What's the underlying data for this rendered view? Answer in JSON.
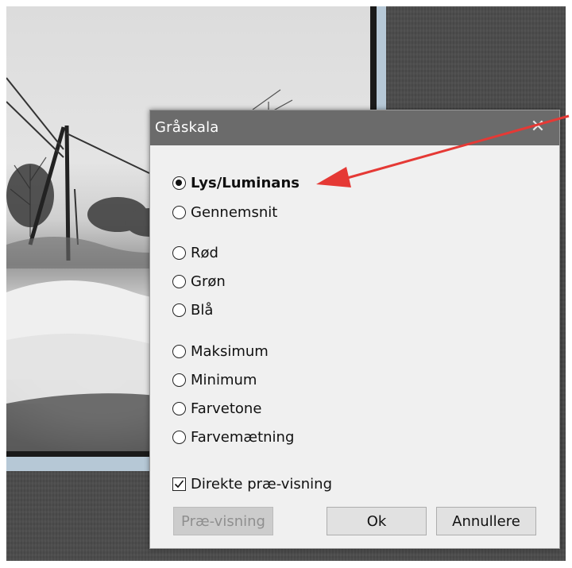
{
  "dialog": {
    "title": "Gråskala",
    "close_icon": "close-icon",
    "modes": [
      {
        "label": "Lys/Luminans",
        "checked": true
      },
      {
        "label": "Gennemsnit",
        "checked": false
      },
      {
        "label": "Rød",
        "checked": false
      },
      {
        "label": "Grøn",
        "checked": false
      },
      {
        "label": "Blå",
        "checked": false
      },
      {
        "label": "Maksimum",
        "checked": false
      },
      {
        "label": "Minimum",
        "checked": false
      },
      {
        "label": "Farvetone",
        "checked": false
      },
      {
        "label": "Farvemætning",
        "checked": false
      }
    ],
    "direct_preview": {
      "label": "Direkte præ-visning",
      "checked": true
    },
    "buttons": {
      "preview": "Præ-visning",
      "ok": "Ok",
      "cancel": "Annullere"
    }
  },
  "annotation": {
    "arrow_color": "#e53935"
  }
}
